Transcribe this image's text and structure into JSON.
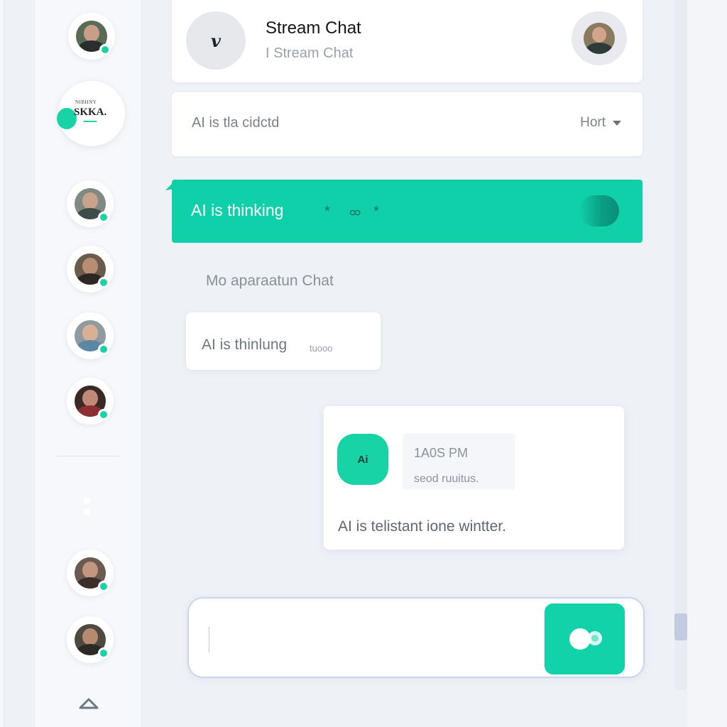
{
  "header": {
    "logo_glyph": "v",
    "title": "Stream Chat",
    "subtitle": "I Stream Chat"
  },
  "sidebar": {
    "server_badge": {
      "line1": "NIBHNY",
      "line2": "SKKA."
    },
    "avatars": [
      "user-avatar-1",
      "user-avatar-2",
      "user-avatar-3",
      "user-avatar-4",
      "user-avatar-5",
      "user-avatar-6",
      "user-avatar-7"
    ]
  },
  "filter": {
    "text": "AI is tla cidctd",
    "select_label": "Hort"
  },
  "banner": {
    "label": "AI is thinking",
    "symbols": [
      "*",
      "ထ",
      "*"
    ]
  },
  "section_label": "Mo aparaatun Chat",
  "bubble": {
    "label": "AI is thinlung",
    "small": "tuooo"
  },
  "ai_card": {
    "avatar_text": "Ai",
    "time": "1A0S PM",
    "status": "seod ruuitus.",
    "text": "AI is telistant  ione wintter."
  },
  "composer": {
    "value": "",
    "placeholder": ""
  },
  "colors": {
    "accent": "#0fd0a8",
    "background": "#eef1f6",
    "card": "#ffffff",
    "text_muted": "#7b818c"
  }
}
